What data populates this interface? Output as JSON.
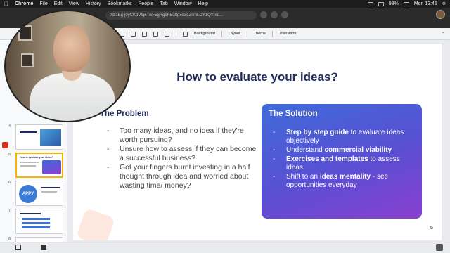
{
  "menubar": {
    "app": "Chrome",
    "items": [
      "File",
      "Edit",
      "View",
      "History",
      "Bookmarks",
      "People",
      "Tab",
      "Window",
      "Help"
    ],
    "battery": "93%",
    "clock": "Mon 13:45"
  },
  "browser": {
    "address_fragment": "f/d/1Bg-j0yCKdVfq6TwF5gRg9FEu8pxe3qZsmLDY1QY/ed..."
  },
  "toolbar": {
    "background": "Background",
    "layout": "Layout",
    "theme": "Theme",
    "transition": "Transition"
  },
  "filmstrip": {
    "thumbs": [
      {
        "num": "4",
        "label": ""
      },
      {
        "num": "5",
        "label": "How to evaluate your ideas?"
      },
      {
        "num": "6",
        "label": "APPY"
      },
      {
        "num": "7",
        "label": ""
      },
      {
        "num": "8",
        "label": ""
      }
    ]
  },
  "slide": {
    "title": "How to evaluate your ideas?",
    "problem_heading": "The Problem",
    "problems": [
      "Too many ideas, and no idea if they’re worth pursuing?",
      "Unsure how to assess if they can become a successful business?",
      "Got your fingers burnt investing in a half thought through idea and worried about wasting time/ money?"
    ],
    "solution_heading": "The Solution",
    "solutions": [
      {
        "bold": "Step by step guide",
        "rest": " to evaluate ideas objectively",
        "pre": ""
      },
      {
        "pre": "Understand ",
        "bold": "commercial viability",
        "rest": ""
      },
      {
        "bold": "Exercises and templates",
        "rest": " to assess ideas",
        "pre": ""
      },
      {
        "pre": "Shift to an ",
        "bold": "ideas mentality",
        "rest": " - see opportunities everyday"
      }
    ],
    "number": "5"
  },
  "colors": {
    "title": "#1f2a5a",
    "solution_gradient_start": "#3f6bd9",
    "solution_gradient_end": "#8a3fd0",
    "selected_thumb": "#f4b400"
  }
}
